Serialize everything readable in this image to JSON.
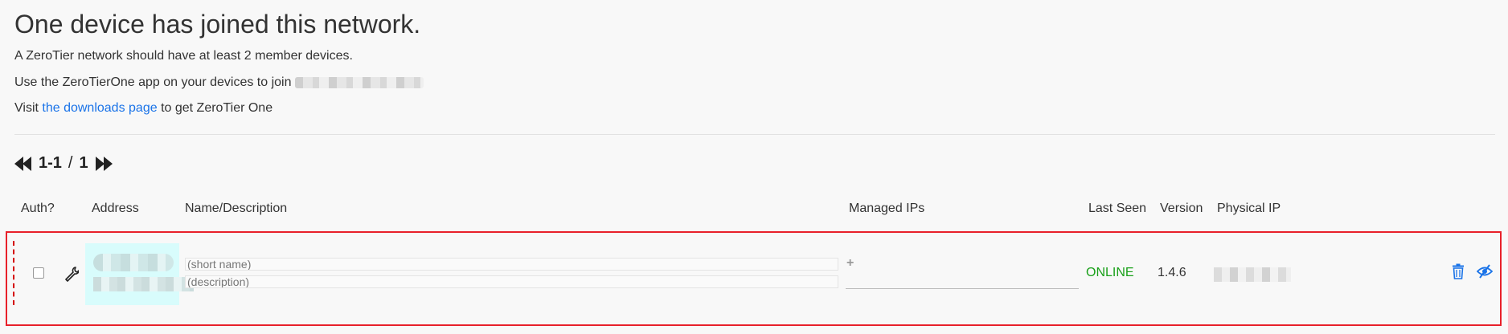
{
  "header": {
    "title": "One device has joined this network.",
    "line1": "A ZeroTier network should have at least 2 member devices.",
    "line2_prefix": "Use the ZeroTierOne app on your devices to join",
    "line3_prefix": "Visit",
    "line3_link": "the downloads page",
    "line3_suffix": "to get ZeroTier One"
  },
  "pager": {
    "range": "1-1",
    "separator": "/",
    "total": "1"
  },
  "table": {
    "columns": {
      "auth": "Auth?",
      "address": "Address",
      "name": "Name/Description",
      "managed_ips": "Managed IPs",
      "last_seen": "Last Seen",
      "version": "Version",
      "physical_ip": "Physical IP"
    },
    "rows": [
      {
        "authorized": false,
        "name_placeholder": "(short name)",
        "description_placeholder": "(description)",
        "last_seen": "ONLINE",
        "version": "1.4.6"
      }
    ]
  },
  "colors": {
    "link": "#1a73e8",
    "online": "#1aa01a",
    "highlight_border": "#e8202a",
    "address_bg": "#d8fcfc",
    "action_icon": "#1a73e8"
  },
  "icons": [
    "rewind-icon",
    "fast-forward-icon",
    "wrench-icon",
    "add-icon",
    "trash-icon",
    "eye-slash-icon"
  ]
}
